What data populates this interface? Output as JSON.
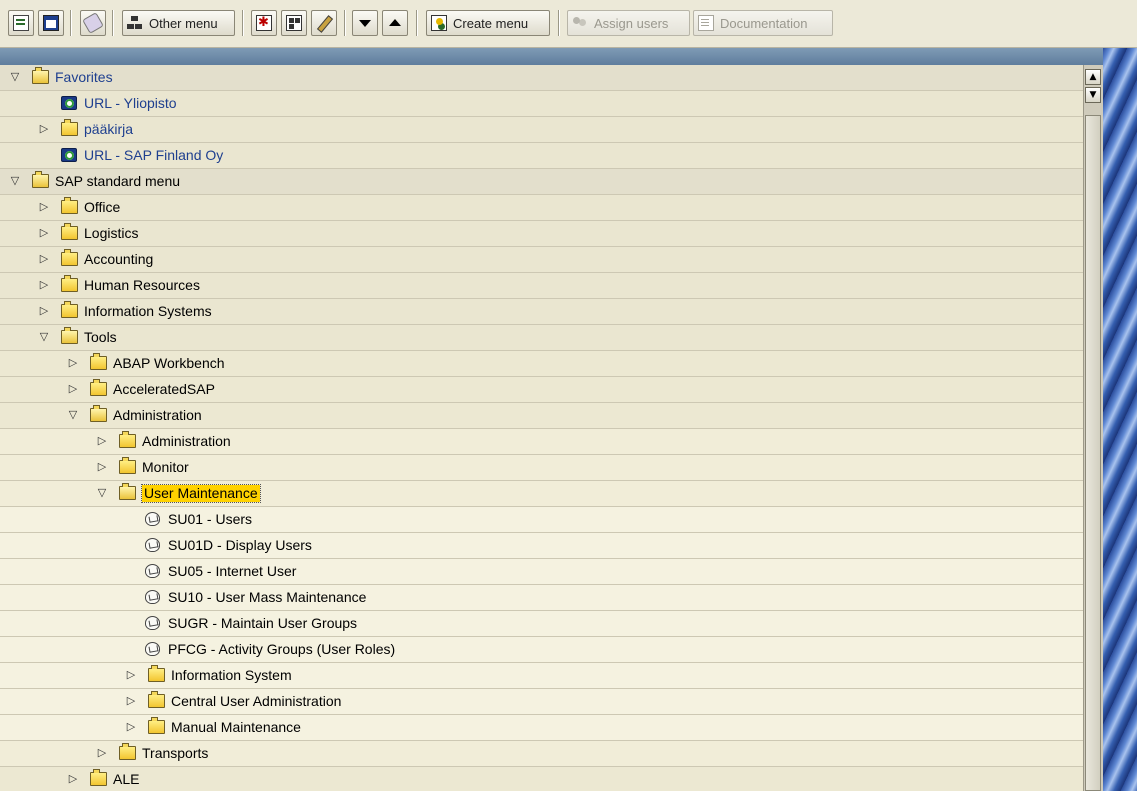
{
  "toolbar": {
    "other_menu": "Other menu",
    "create_menu": "Create menu",
    "assign_users": "Assign users",
    "documentation": "Documentation"
  },
  "tree": {
    "rows": [
      {
        "level": 0,
        "expander": "open",
        "icon": "folder-open",
        "label": "Favorites",
        "style": "favorites"
      },
      {
        "level": 1,
        "expander": "none",
        "icon": "url",
        "label": "URL - Yliopisto",
        "style": "favorites"
      },
      {
        "level": 1,
        "expander": "closed",
        "icon": "folder",
        "label": "pääkirja",
        "style": "favorites"
      },
      {
        "level": 1,
        "expander": "none",
        "icon": "url",
        "label": "URL - SAP Finland Oy",
        "style": "favorites"
      },
      {
        "level": 0,
        "expander": "open",
        "icon": "folder-open",
        "label": "SAP standard menu",
        "style": "normal"
      },
      {
        "level": 1,
        "expander": "closed",
        "icon": "folder",
        "label": "Office",
        "style": "normal"
      },
      {
        "level": 1,
        "expander": "closed",
        "icon": "folder",
        "label": "Logistics",
        "style": "normal"
      },
      {
        "level": 1,
        "expander": "closed",
        "icon": "folder",
        "label": "Accounting",
        "style": "normal"
      },
      {
        "level": 1,
        "expander": "closed",
        "icon": "folder",
        "label": "Human Resources",
        "style": "normal"
      },
      {
        "level": 1,
        "expander": "closed",
        "icon": "folder",
        "label": "Information Systems",
        "style": "normal"
      },
      {
        "level": 1,
        "expander": "open",
        "icon": "folder-open",
        "label": "Tools",
        "style": "normal"
      },
      {
        "level": 2,
        "expander": "closed",
        "icon": "folder",
        "label": "ABAP Workbench",
        "style": "normal"
      },
      {
        "level": 2,
        "expander": "closed",
        "icon": "folder",
        "label": "AcceleratedSAP",
        "style": "normal"
      },
      {
        "level": 2,
        "expander": "open",
        "icon": "folder-open",
        "label": "Administration",
        "style": "normal"
      },
      {
        "level": 3,
        "expander": "closed",
        "icon": "folder",
        "label": "Administration",
        "style": "normal"
      },
      {
        "level": 3,
        "expander": "closed",
        "icon": "folder",
        "label": "Monitor",
        "style": "normal"
      },
      {
        "level": 3,
        "expander": "open",
        "icon": "folder-open",
        "label": "User Maintenance",
        "style": "selected"
      },
      {
        "level": 5,
        "expander": "none",
        "icon": "transaction",
        "label": "SU01 - Users",
        "style": "normal"
      },
      {
        "level": 5,
        "expander": "none",
        "icon": "transaction",
        "label": "SU01D - Display Users",
        "style": "normal"
      },
      {
        "level": 5,
        "expander": "none",
        "icon": "transaction",
        "label": "SU05 - Internet User",
        "style": "normal"
      },
      {
        "level": 5,
        "expander": "none",
        "icon": "transaction",
        "label": "SU10 - User Mass Maintenance",
        "style": "normal"
      },
      {
        "level": 5,
        "expander": "none",
        "icon": "transaction",
        "label": "SUGR - Maintain User Groups",
        "style": "normal"
      },
      {
        "level": 5,
        "expander": "none",
        "icon": "transaction",
        "label": "PFCG - Activity Groups (User Roles)",
        "style": "normal"
      },
      {
        "level": 4,
        "expander": "closed",
        "icon": "folder",
        "label": "Information System",
        "style": "normal"
      },
      {
        "level": 4,
        "expander": "closed",
        "icon": "folder",
        "label": "Central User Administration",
        "style": "normal"
      },
      {
        "level": 4,
        "expander": "closed",
        "icon": "folder",
        "label": "Manual Maintenance",
        "style": "normal"
      },
      {
        "level": 3,
        "expander": "closed",
        "icon": "folder",
        "label": "Transports",
        "style": "normal"
      },
      {
        "level": 2,
        "expander": "closed",
        "icon": "folder",
        "label": "ALE",
        "style": "normal"
      }
    ]
  }
}
